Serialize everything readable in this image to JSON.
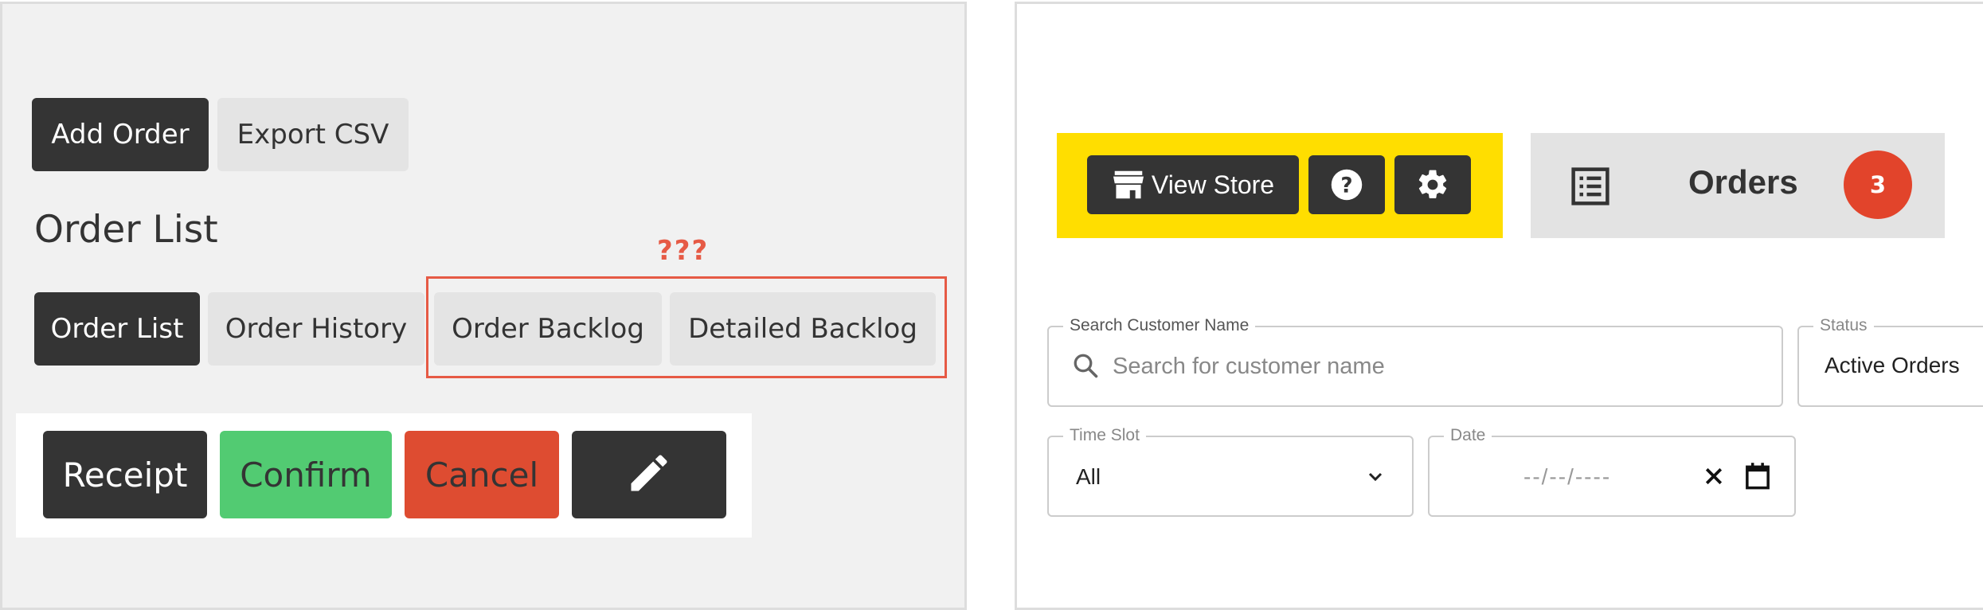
{
  "left": {
    "toolbar": {
      "add_order": "Add Order",
      "export_csv": "Export CSV"
    },
    "title": "Order List",
    "annotation": "???",
    "tabs": [
      {
        "label": "Order List"
      },
      {
        "label": "Order History"
      },
      {
        "label": "Order Backlog"
      },
      {
        "label": "Detailed Backlog"
      }
    ],
    "actions": {
      "receipt": "Receipt",
      "confirm": "Confirm",
      "cancel": "Cancel",
      "edit_icon": "pencil-icon"
    }
  },
  "right": {
    "toolbar": {
      "view_store": "View Store",
      "store_icon": "store-icon",
      "help_icon": "help-icon",
      "settings_icon": "gear-icon"
    },
    "orders": {
      "label": "Orders",
      "count": "3",
      "icon": "list-icon"
    },
    "search": {
      "label": "Search Customer Name",
      "placeholder": "Search for customer name"
    },
    "status": {
      "label": "Status",
      "value": "Active Orders"
    },
    "time_slot": {
      "label": "Time Slot",
      "value": "All"
    },
    "date": {
      "label": "Date",
      "placeholder": "--/--/----"
    }
  },
  "colors": {
    "dark": "#343434",
    "light_button": "#e4e4e4",
    "green": "#52cb72",
    "red": "#de4c31",
    "yellow": "#ffde00",
    "badge": "#e2442b",
    "annotation": "#e65a45"
  }
}
